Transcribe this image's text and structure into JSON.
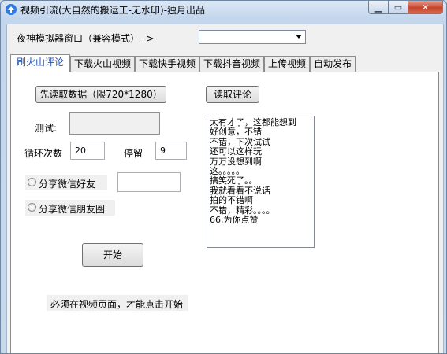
{
  "window": {
    "title": "视频引流(大自然的搬运工-无水印)-独月出品",
    "controls": {
      "minimize": "▁",
      "maximize": "▭",
      "close": "✕"
    }
  },
  "top": {
    "emulator_label": "夜神模拟器窗口（兼容模式）-->",
    "emulator_value": ""
  },
  "tabs": [
    {
      "label": "刷火山评论",
      "active": true
    },
    {
      "label": "下载火山视频"
    },
    {
      "label": "下载快手视频"
    },
    {
      "label": "下载抖音视频"
    },
    {
      "label": "上传视频"
    },
    {
      "label": "自动发布"
    }
  ],
  "panel": {
    "read_data_button": "先读取数据（限720*1280）",
    "read_comments_button": "读取评论",
    "test_label": "测试:",
    "test_value": "",
    "loop_label": "循环次数",
    "loop_value": "20",
    "stay_label": "停留",
    "stay_value": "9",
    "share_friends_label": "分享微信好友",
    "share_friends_value": "",
    "share_moments_label": "分享微信朋友圈",
    "start_button": "开始",
    "note": "必须在视频页面，才能点击开始",
    "comments": [
      "太有才了，这都能想到",
      "好创意，不错",
      "不错，下次试试",
      "还可以这样玩",
      "万万没想到啊",
      "这。。。。。",
      "搞笑死了。。",
      "我就看看不说话",
      "拍的不错啊",
      "不错，精彩。。。。",
      "66,为你点赞"
    ]
  }
}
